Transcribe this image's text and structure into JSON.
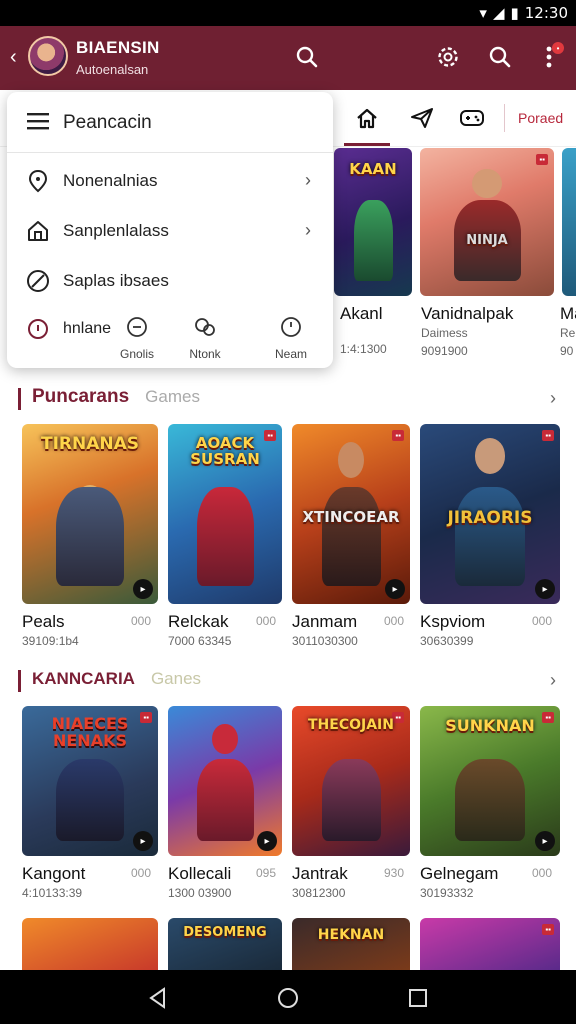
{
  "status": {
    "time": "12:30"
  },
  "header": {
    "title": "BIAENSIN",
    "subtitle": "Autoenalsan"
  },
  "tabs": {
    "right_label": "Poraed"
  },
  "menu": {
    "title": "Peancacin",
    "items": [
      {
        "label": "Nonenalnias",
        "icon": "location-icon",
        "has_chevron": true
      },
      {
        "label": "Sanplenlalass",
        "icon": "home-icon",
        "has_chevron": true
      },
      {
        "label": "Saplas ibsaes",
        "icon": "block-icon",
        "has_chevron": false
      }
    ],
    "bottom_label": "hnlane",
    "bottom_icons": [
      {
        "label": "Gnolis",
        "icon": "controller-icon"
      },
      {
        "label": "Ntonk",
        "icon": "chat-icon"
      },
      {
        "label": "Neam",
        "icon": "info-icon"
      }
    ]
  },
  "top_row": [
    {
      "title": "Akanl",
      "meta": "1:4:1300",
      "logo": "KAAN"
    },
    {
      "title": "Vanidnalpak",
      "meta": "Daimess\n9091900",
      "logo": "NINJA"
    },
    {
      "title": "Ma",
      "meta": "Re\n90",
      "logo": ""
    }
  ],
  "sections": [
    {
      "title": "Puncarans",
      "subtitle": "Games",
      "cards": [
        {
          "title": "Peals",
          "rating": "000",
          "meta": "39109:1b4",
          "logo": "TIRNANAS"
        },
        {
          "title": "Relckak",
          "rating": "000",
          "meta": "7000 63345",
          "logo": "AOACK SUSRAN"
        },
        {
          "title": "Janmam",
          "rating": "000",
          "meta": "3011030300",
          "logo": "XTINCOEAR"
        },
        {
          "title": "Kspviom",
          "rating": "000",
          "meta": "30630399",
          "logo": "JIRAORIS"
        }
      ]
    },
    {
      "title": "KANNCARIA",
      "subtitle": "Ganes",
      "cards": [
        {
          "title": "Kangont",
          "rating": "000",
          "meta": "4:10133:39",
          "logo": "NIAECES NENAKS"
        },
        {
          "title": "Kollecali",
          "rating": "095",
          "meta": "1300 03900",
          "logo": ""
        },
        {
          "title": "Jantrak",
          "rating": "930",
          "meta": "30812300",
          "logo": "THECOJAIN"
        },
        {
          "title": "Gelnegam",
          "rating": "000",
          "meta": "30193332",
          "logo": "SUNKNAN"
        }
      ]
    }
  ],
  "bottom_row": [
    {
      "logo": ""
    },
    {
      "logo": "DESOMENG"
    },
    {
      "logo": "HEKNAN"
    },
    {
      "logo": ""
    }
  ],
  "colors": {
    "brand": "#6f2032",
    "accent": "#7a1f35",
    "badge": "#e0393e"
  }
}
